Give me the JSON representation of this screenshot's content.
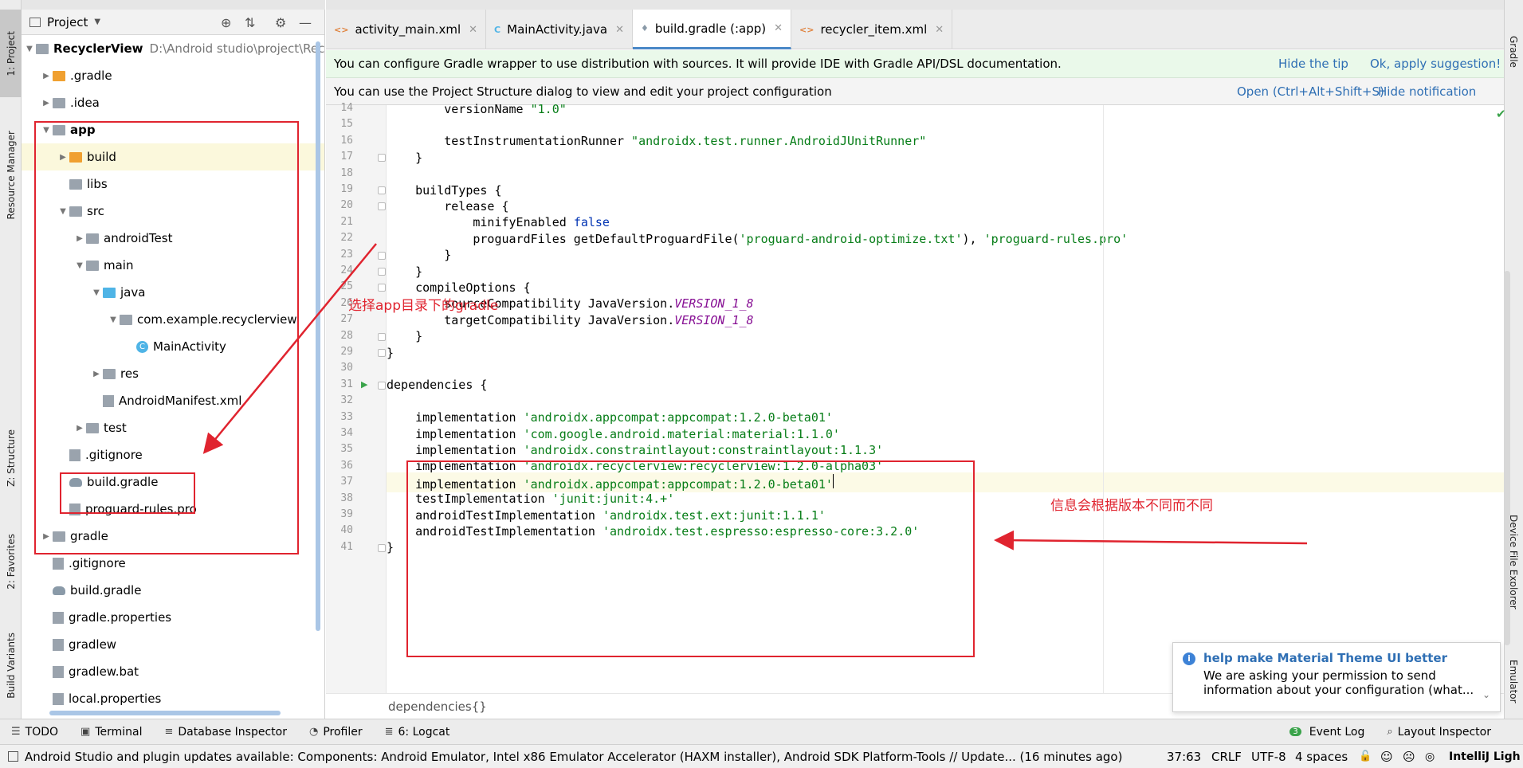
{
  "project_panel": {
    "title": "Project",
    "root_name": "RecyclerView",
    "root_path": "D:\\Android studio\\project\\Rec",
    "items": [
      {
        "label": ".gradle",
        "depth": 1,
        "icon": "folder-orange",
        "arrow": "right"
      },
      {
        "label": ".idea",
        "depth": 1,
        "icon": "folder",
        "arrow": "right"
      },
      {
        "label": "app",
        "depth": 1,
        "icon": "folder",
        "arrow": "down",
        "bold": true
      },
      {
        "label": "build",
        "depth": 2,
        "icon": "folder-orange",
        "arrow": "right"
      },
      {
        "label": "libs",
        "depth": 2,
        "icon": "folder",
        "arrow": ""
      },
      {
        "label": "src",
        "depth": 2,
        "icon": "folder",
        "arrow": "down"
      },
      {
        "label": "androidTest",
        "depth": 3,
        "icon": "folder",
        "arrow": "right"
      },
      {
        "label": "main",
        "depth": 3,
        "icon": "folder",
        "arrow": "down"
      },
      {
        "label": "java",
        "depth": 4,
        "icon": "folder-blue",
        "arrow": "down"
      },
      {
        "label": "com.example.recyclerview",
        "depth": 5,
        "icon": "package",
        "arrow": "down"
      },
      {
        "label": "MainActivity",
        "depth": 6,
        "icon": "class",
        "arrow": ""
      },
      {
        "label": "res",
        "depth": 4,
        "icon": "folder",
        "arrow": "right"
      },
      {
        "label": "AndroidManifest.xml",
        "depth": 4,
        "icon": "manifest",
        "arrow": ""
      },
      {
        "label": "test",
        "depth": 3,
        "icon": "folder",
        "arrow": "right"
      },
      {
        "label": ".gitignore",
        "depth": 2,
        "icon": "file",
        "arrow": ""
      },
      {
        "label": "build.gradle",
        "depth": 2,
        "icon": "gradle",
        "arrow": ""
      },
      {
        "label": "proguard-rules.pro",
        "depth": 2,
        "icon": "file",
        "arrow": ""
      },
      {
        "label": "gradle",
        "depth": 1,
        "icon": "folder",
        "arrow": "right"
      },
      {
        "label": ".gitignore",
        "depth": 1,
        "icon": "file",
        "arrow": ""
      },
      {
        "label": "build.gradle",
        "depth": 1,
        "icon": "gradle",
        "arrow": ""
      },
      {
        "label": "gradle.properties",
        "depth": 1,
        "icon": "file",
        "arrow": ""
      },
      {
        "label": "gradlew",
        "depth": 1,
        "icon": "file",
        "arrow": ""
      },
      {
        "label": "gradlew.bat",
        "depth": 1,
        "icon": "file",
        "arrow": ""
      },
      {
        "label": "local.properties",
        "depth": 1,
        "icon": "file",
        "arrow": ""
      }
    ]
  },
  "left_tabs": [
    "1: Project",
    "Resource Manager",
    "Z: Structure",
    "2: Favorites",
    "Build Variants"
  ],
  "right_tabs": [
    "Gradle",
    "Device File Explorer",
    "Emulator"
  ],
  "editor_tabs": [
    {
      "label": "activity_main.xml",
      "icon": "xml-icon"
    },
    {
      "label": "MainActivity.java",
      "icon": "class-icon"
    },
    {
      "label": "build.gradle (:app)",
      "icon": "gradle-icon",
      "active": true
    },
    {
      "label": "recycler_item.xml",
      "icon": "xml-icon"
    }
  ],
  "tip_bar": {
    "text": "You can configure Gradle wrapper to use distribution with sources. It will provide IDE with Gradle API/DSL documentation.",
    "hide": "Hide the tip",
    "apply": "Ok, apply suggestion!"
  },
  "info_bar": {
    "text": "You can use the Project Structure dialog to view and edit your project configuration",
    "open": "Open (Ctrl+Alt+Shift+S)",
    "hide": "Hide notification"
  },
  "code_lines": [
    {
      "n": "14",
      "text": "        versionName \"1.0\""
    },
    {
      "n": "15",
      "text": ""
    },
    {
      "n": "16",
      "text": "        testInstrumentationRunner \"androidx.test.runner.AndroidJUnitRunner\""
    },
    {
      "n": "17",
      "text": "    }"
    },
    {
      "n": "18",
      "text": ""
    },
    {
      "n": "19",
      "text": "    buildTypes {"
    },
    {
      "n": "20",
      "text": "        release {"
    },
    {
      "n": "21",
      "text": "            minifyEnabled false"
    },
    {
      "n": "22",
      "text": "            proguardFiles getDefaultProguardFile('proguard-android-optimize.txt'), 'proguard-rules.pro'"
    },
    {
      "n": "23",
      "text": "        }"
    },
    {
      "n": "24",
      "text": "    }"
    },
    {
      "n": "25",
      "text": "    compileOptions {"
    },
    {
      "n": "26",
      "text": "        sourceCompatibility JavaVersion.VERSION_1_8"
    },
    {
      "n": "27",
      "text": "        targetCompatibility JavaVersion.VERSION_1_8"
    },
    {
      "n": "28",
      "text": "    }"
    },
    {
      "n": "29",
      "text": "}"
    },
    {
      "n": "30",
      "text": ""
    },
    {
      "n": "31",
      "text": "dependencies {"
    },
    {
      "n": "32",
      "text": ""
    },
    {
      "n": "33",
      "text": "    implementation 'androidx.appcompat:appcompat:1.2.0-beta01'"
    },
    {
      "n": "34",
      "text": "    implementation 'com.google.android.material:material:1.1.0'"
    },
    {
      "n": "35",
      "text": "    implementation 'androidx.constraintlayout:constraintlayout:1.1.3'"
    },
    {
      "n": "36",
      "text": "    implementation 'androidx.recyclerview:recyclerview:1.2.0-alpha03'"
    },
    {
      "n": "37",
      "text": "    implementation 'androidx.appcompat:appcompat:1.2.0-beta01'"
    },
    {
      "n": "38",
      "text": "    testImplementation 'junit:junit:4.+'"
    },
    {
      "n": "39",
      "text": "    androidTestImplementation 'androidx.test.ext:junit:1.1.1'"
    },
    {
      "n": "40",
      "text": "    androidTestImplementation 'androidx.test.espresso:espresso-core:3.2.0'"
    },
    {
      "n": "41",
      "text": "}"
    }
  ],
  "breadcrumb": "dependencies{}",
  "annotations": {
    "select_app_gradle": "选择app目录下的gradle",
    "info_varies": "信息会根据版本不同而不同"
  },
  "notification": {
    "title": "help make Material Theme UI better",
    "body1": "We are asking your permission to send",
    "body2": "information about your configuration (what..."
  },
  "bottom_tabs": [
    {
      "label": "TODO",
      "icon": "list-icon"
    },
    {
      "label": "Terminal",
      "icon": "terminal-icon"
    },
    {
      "label": "Database Inspector",
      "icon": "database-icon"
    },
    {
      "label": "Profiler",
      "icon": "profiler-icon"
    },
    {
      "label": "6: Logcat",
      "icon": "logcat-icon"
    }
  ],
  "bottom_right_tabs": [
    {
      "label": "Event Log",
      "icon": "event-log-icon",
      "badge": "3"
    },
    {
      "label": "Layout Inspector",
      "icon": "layout-inspector-icon"
    }
  ],
  "status": {
    "message": "Android Studio and plugin updates available: Components: Android Emulator, Intel x86 Emulator Accelerator (HAXM installer), Android SDK Platform-Tools // Update... (16 minutes ago)",
    "position": "37:63",
    "line_sep": "CRLF",
    "encoding": "UTF-8",
    "indent": "4 spaces",
    "theme": "IntelliJ Ligh"
  },
  "colors": {
    "annotation": "#e0242f",
    "link": "#2f6fb4",
    "string": "#067d17",
    "keyword": "#0033b3"
  }
}
